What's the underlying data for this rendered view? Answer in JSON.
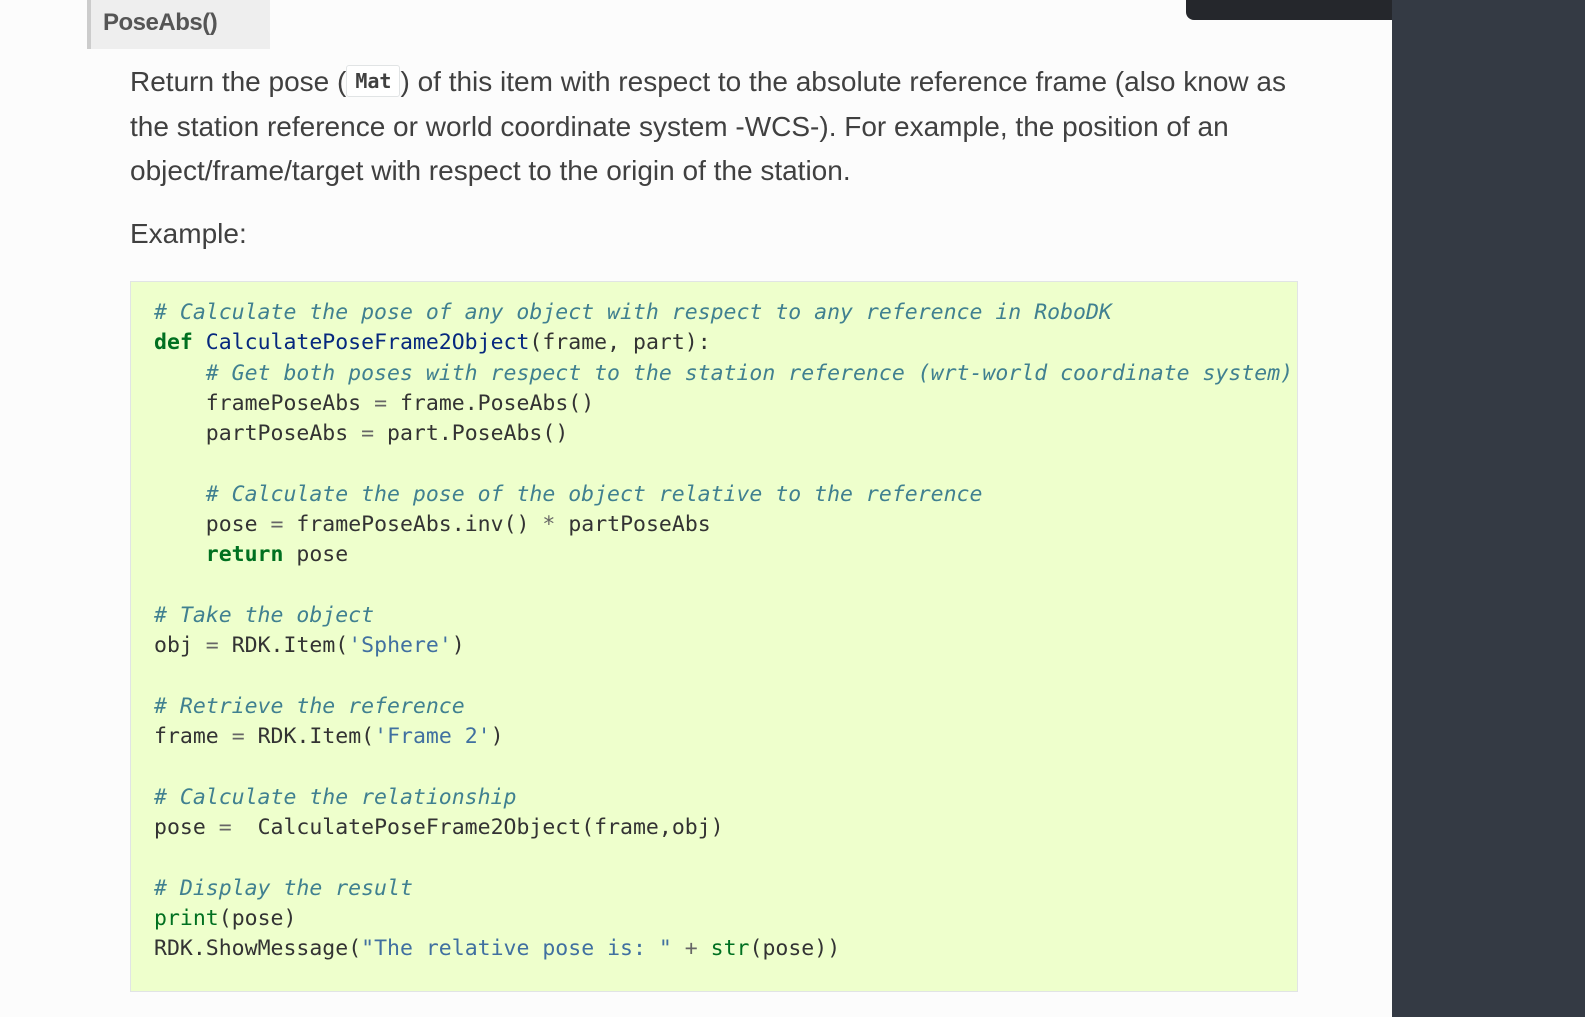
{
  "header": {
    "signature": "PoseAbs()"
  },
  "description": {
    "before_code": "Return the pose (",
    "code": "Mat",
    "after_code": ") of this item with respect to the absolute reference frame (also know as the station reference or world coordinate system -WCS-). For example, the position of an object/frame/target with respect to the origin of the station."
  },
  "example_label": "Example:",
  "code": {
    "language": "python",
    "lines": [
      "# Calculate the pose of any object with respect to any reference in RoboDK",
      "def CalculatePoseFrame2Object(frame, part):",
      "    # Get both poses with respect to the station reference (wrt-world coordinate system)",
      "    framePoseAbs = frame.PoseAbs()",
      "    partPoseAbs = part.PoseAbs()",
      "",
      "    # Calculate the pose of the object relative to the reference",
      "    pose = framePoseAbs.inv() * partPoseAbs",
      "    return pose",
      "",
      "# Take the object",
      "obj = RDK.Item('Sphere')",
      "",
      "# Retrieve the reference",
      "frame = RDK.Item('Frame 2')",
      "",
      "# Calculate the relationship",
      "pose =  CalculatePoseFrame2Object(frame,obj)",
      "",
      "# Display the result",
      "print(pose)",
      "RDK.ShowMessage(\"The relative pose is: \" + str(pose))"
    ]
  },
  "colors": {
    "code_background": "#eeffcc",
    "comment": "#408090",
    "keyword": "#007020",
    "function_name": "#06287e",
    "string": "#4070a0",
    "sidebar": "#343a44"
  }
}
